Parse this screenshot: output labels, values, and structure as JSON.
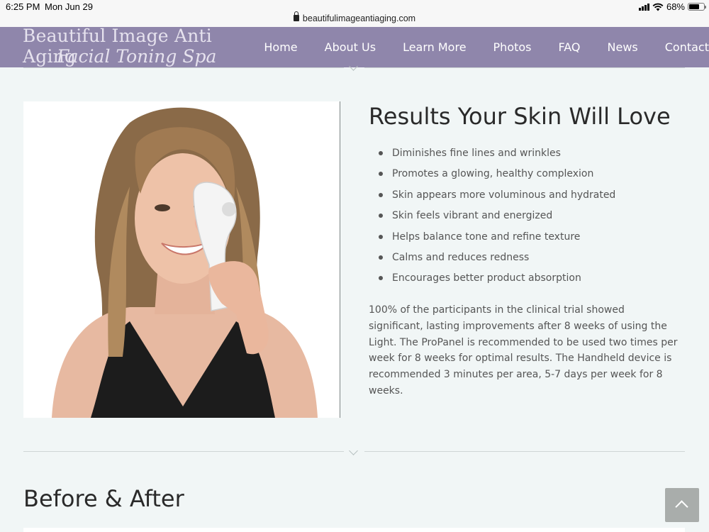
{
  "status_bar": {
    "time": "6:25 PM",
    "date": "Mon Jun 29",
    "url": "beautifulimageantiaging.com",
    "battery": "68%",
    "battery_level": 0.68
  },
  "header": {
    "logo_line1": "Beautiful Image Anti Aging",
    "logo_line2": "Facial Toning Spa",
    "nav": [
      "Home",
      "About Us",
      "Learn More",
      "Photos",
      "FAQ",
      "News",
      "Contact"
    ]
  },
  "main": {
    "image_alt": "Woman holding handheld light therapy device to cheek",
    "heading": "Results Your Skin Will Love",
    "bullets": [
      "Diminishes fine lines and wrinkles",
      "Promotes a glowing, healthy complexion",
      "Skin appears more voluminous and hydrated",
      "Skin feels vibrant and energized",
      "Helps balance tone and refine texture",
      "Calms and reduces redness",
      "Encourages better product absorption"
    ],
    "paragraph": "100% of the participants in the clinical trial showed significant, lasting improvements after 8 weeks of using the Light. The ProPanel is recommended to be used two times per week for 8 weeks for optimal results. The Handheld device is recommended 3 minutes per area, 5-7 days per week for 8 weeks."
  },
  "before_after": {
    "heading": "Before & After"
  },
  "colors": {
    "header_bg": "#8f86ab",
    "page_bg": "#f1f6f6",
    "back_to_top_bg": "#a9adab"
  },
  "icons": [
    "lock-icon",
    "signal-icon",
    "wifi-icon",
    "battery-icon",
    "chevron-down-icon",
    "chevron-up-icon"
  ]
}
